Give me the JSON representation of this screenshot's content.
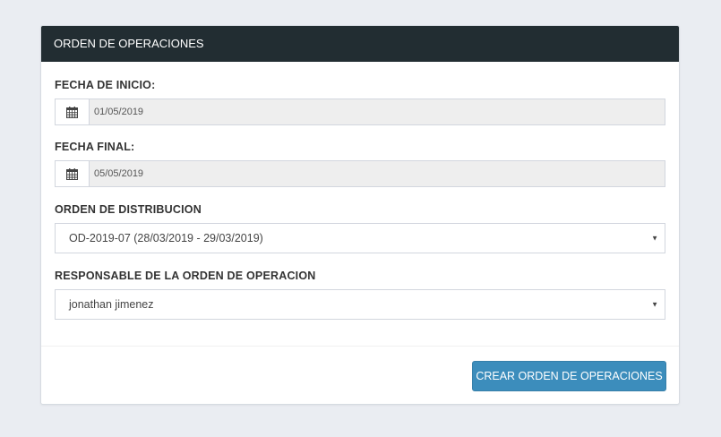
{
  "panel": {
    "title": "ORDEN DE OPERACIONES"
  },
  "fields": {
    "fecha_inicio": {
      "label": "FECHA DE INICIO:",
      "icon": "calendar-icon",
      "value": "01/05/2019"
    },
    "fecha_final": {
      "label": "FECHA FINAL:",
      "icon": "calendar-icon",
      "value": "05/05/2019"
    },
    "orden_distribucion": {
      "label": "ORDEN DE DISTRIBUCION",
      "selected": "OD-2019-07 (28/03/2019 - 29/03/2019)"
    },
    "responsable": {
      "label": "RESPONSABLE DE LA ORDEN DE OPERACION",
      "selected": "jonathan jimenez"
    }
  },
  "footer": {
    "submit_label": "CREAR ORDEN DE OPERACIONES"
  },
  "colors": {
    "header_bg": "#222d32",
    "button_bg": "#3c8dbc",
    "page_bg": "#eaedf2",
    "readonly_bg": "#eeeeee"
  }
}
